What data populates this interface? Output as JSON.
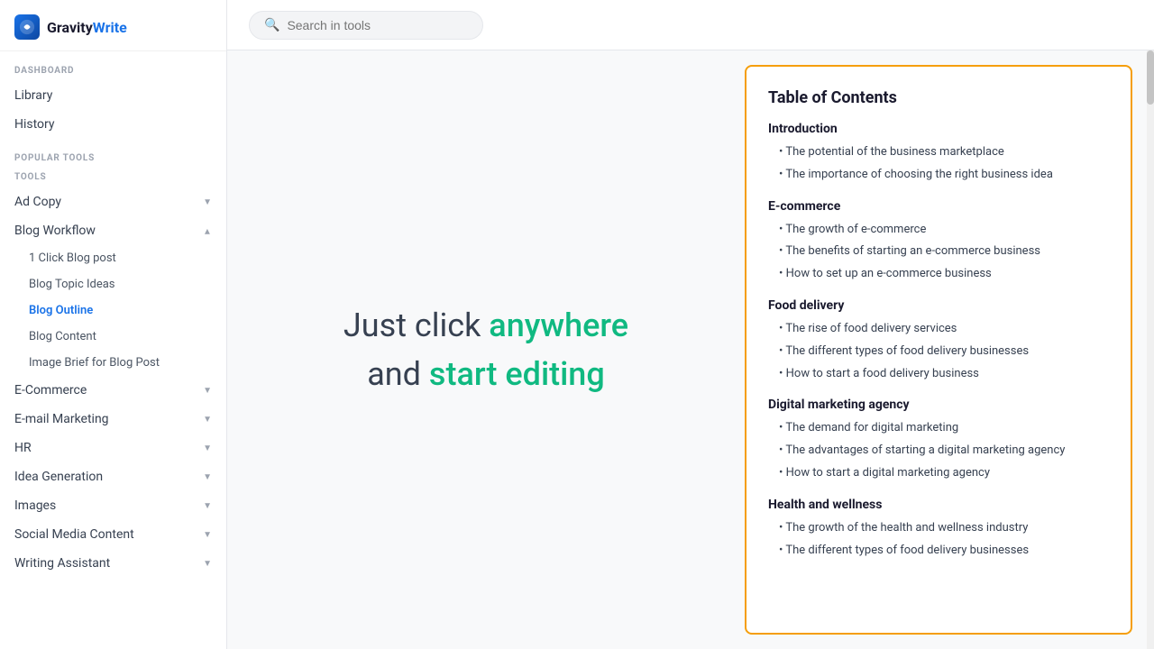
{
  "logo": {
    "icon": "G",
    "text_brand": "Gravity",
    "text_product": "Write"
  },
  "sidebar": {
    "dashboard_label": "DASHBOARD",
    "tools_label": "TOOLS",
    "popular_tools_label": "POPULAR TOOLS",
    "dashboard_links": [
      {
        "id": "library",
        "label": "Library"
      },
      {
        "id": "history",
        "label": "History"
      }
    ],
    "tools": [
      {
        "id": "ad-copy",
        "label": "Ad Copy",
        "expanded": false,
        "children": []
      },
      {
        "id": "blog-workflow",
        "label": "Blog Workflow",
        "expanded": true,
        "children": [
          {
            "id": "1-click-blog-post",
            "label": "1 Click Blog post",
            "active": false
          },
          {
            "id": "blog-topic-ideas",
            "label": "Blog Topic Ideas",
            "active": false
          },
          {
            "id": "blog-outline",
            "label": "Blog Outline",
            "active": true
          },
          {
            "id": "blog-content",
            "label": "Blog Content",
            "active": false
          },
          {
            "id": "image-brief",
            "label": "Image Brief for Blog Post",
            "active": false
          }
        ]
      },
      {
        "id": "e-commerce",
        "label": "E-Commerce",
        "expanded": false,
        "children": []
      },
      {
        "id": "email-marketing",
        "label": "E-mail Marketing",
        "expanded": false,
        "children": []
      },
      {
        "id": "hr",
        "label": "HR",
        "expanded": false,
        "children": []
      },
      {
        "id": "idea-generation",
        "label": "Idea Generation",
        "expanded": false,
        "children": []
      },
      {
        "id": "images",
        "label": "Images",
        "expanded": false,
        "children": []
      },
      {
        "id": "social-media-content",
        "label": "Social Media Content",
        "expanded": false,
        "children": []
      },
      {
        "id": "writing-assistant",
        "label": "Writing Assistant",
        "expanded": false,
        "children": []
      }
    ]
  },
  "topbar": {
    "search_placeholder": "Search in tools"
  },
  "editor": {
    "prompt_text1": "Just click ",
    "prompt_highlight1": "anywhere",
    "prompt_text2": "and ",
    "prompt_highlight2": "start editing"
  },
  "toc": {
    "title": "Table of Contents",
    "sections": [
      {
        "id": "introduction",
        "heading": "Introduction",
        "items": [
          "The potential of the business marketplace",
          "The importance of choosing the right business idea"
        ]
      },
      {
        "id": "e-commerce",
        "heading": "E-commerce",
        "items": [
          "The growth of e-commerce",
          "The benefits of starting an e-commerce business",
          "How to set up an e-commerce business"
        ]
      },
      {
        "id": "food-delivery",
        "heading": "Food delivery",
        "items": [
          "The rise of food delivery services",
          "The different types of food delivery businesses",
          "How to start a food delivery business"
        ]
      },
      {
        "id": "digital-marketing",
        "heading": "Digital marketing agency",
        "items": [
          "The demand for digital marketing",
          "The advantages of starting a digital marketing agency",
          "How to start a digital marketing agency"
        ]
      },
      {
        "id": "health-wellness",
        "heading": "Health and wellness",
        "items": [
          "The growth of the health and wellness industry",
          "The different types of food delivery businesses"
        ]
      }
    ]
  },
  "colors": {
    "accent_blue": "#1a73e8",
    "accent_green": "#10b981",
    "accent_amber": "#f59e0b",
    "text_dark": "#1a1a2e",
    "text_medium": "#374151",
    "text_light": "#9ca3af"
  }
}
